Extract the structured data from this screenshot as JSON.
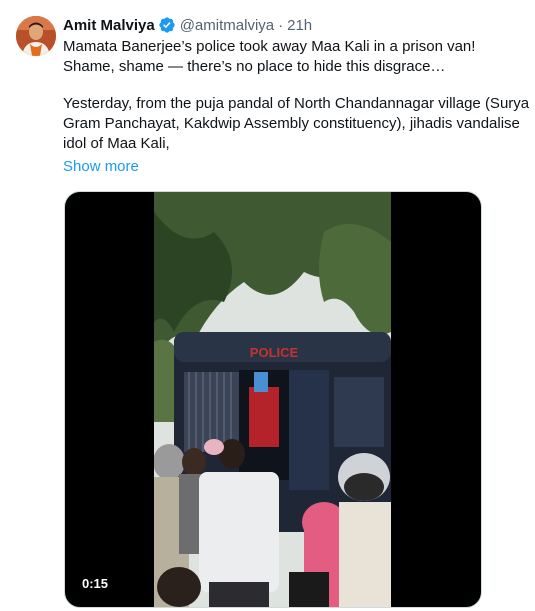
{
  "tweet": {
    "author_name": "Amit Malviya",
    "handle": "@amitmalviya",
    "separator": "·",
    "time": "21h",
    "lines": [
      "Mamata Banerjee’s police took away Maa Kali in a prison van!",
      "Shame, shame — there’s no place to hide this disgrace…",
      "",
      "Yesterday, from the puja pandal of North Chandannagar village (Surya",
      "Gram Panchayat, Kakdwip Assembly constituency), jihadis vandalise",
      "idol of Maa Kali,"
    ],
    "show_more": "Show more"
  },
  "media": {
    "duration": "0:15",
    "van_text": "POLICE"
  },
  "colors": {
    "link": "#1d9bf0",
    "verified": "#1d9bf0",
    "muted": "#536471"
  },
  "icons": {
    "verified": "verified-badge-icon"
  }
}
